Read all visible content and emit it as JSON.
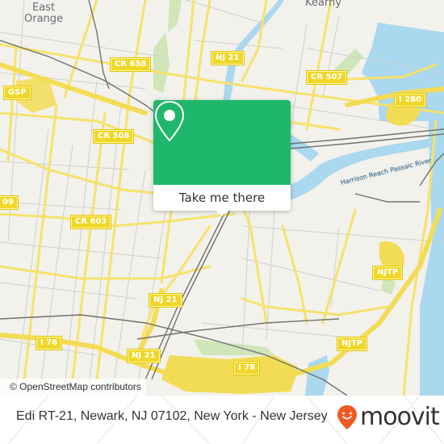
{
  "map": {
    "place_labels": [
      {
        "id": "east-orange",
        "text": "East\nOrange"
      },
      {
        "id": "kearny",
        "text": "Kearny"
      }
    ],
    "road_shields": [
      {
        "id": "cr-658",
        "text": "CR 658"
      },
      {
        "id": "nj-21-north",
        "text": "NJ 21"
      },
      {
        "id": "cr-507",
        "text": "CR 507"
      },
      {
        "id": "gsp",
        "text": "GSP"
      },
      {
        "id": "i-280",
        "text": "I 280"
      },
      {
        "id": "cr-508",
        "text": "CR 508"
      },
      {
        "id": "cr-509",
        "text": "09"
      },
      {
        "id": "cr-603",
        "text": "CR 603"
      },
      {
        "id": "njtp-north",
        "text": "NJTP"
      },
      {
        "id": "nj-21-mid",
        "text": "NJ 21"
      },
      {
        "id": "njtp-south",
        "text": "NJTP"
      },
      {
        "id": "i-78-west",
        "text": "I 78"
      },
      {
        "id": "nj-21-south",
        "text": "NJ 21"
      },
      {
        "id": "i-78-east",
        "text": "I 78"
      }
    ],
    "river_label": "Harrison Reach Passaic River",
    "colors": {
      "land": "#f2f1ec",
      "water": "#aad8ee",
      "park": "#cfe6b8",
      "major_road": "#f5e26b",
      "minor_road": "#c9c9c9",
      "rail": "#707070"
    }
  },
  "popup": {
    "icon": "map-pin-icon",
    "action_label": "Take me there",
    "accent_color": "#1fb76b"
  },
  "attribution": "© OpenStreetMap contributors",
  "footer": {
    "address": "Edi RT-21, Newark, NJ 07102, New York - New Jersey",
    "logo_text": "moovit",
    "logo_icon": "moovit-pin-icon",
    "logo_color": "#f15a24"
  }
}
